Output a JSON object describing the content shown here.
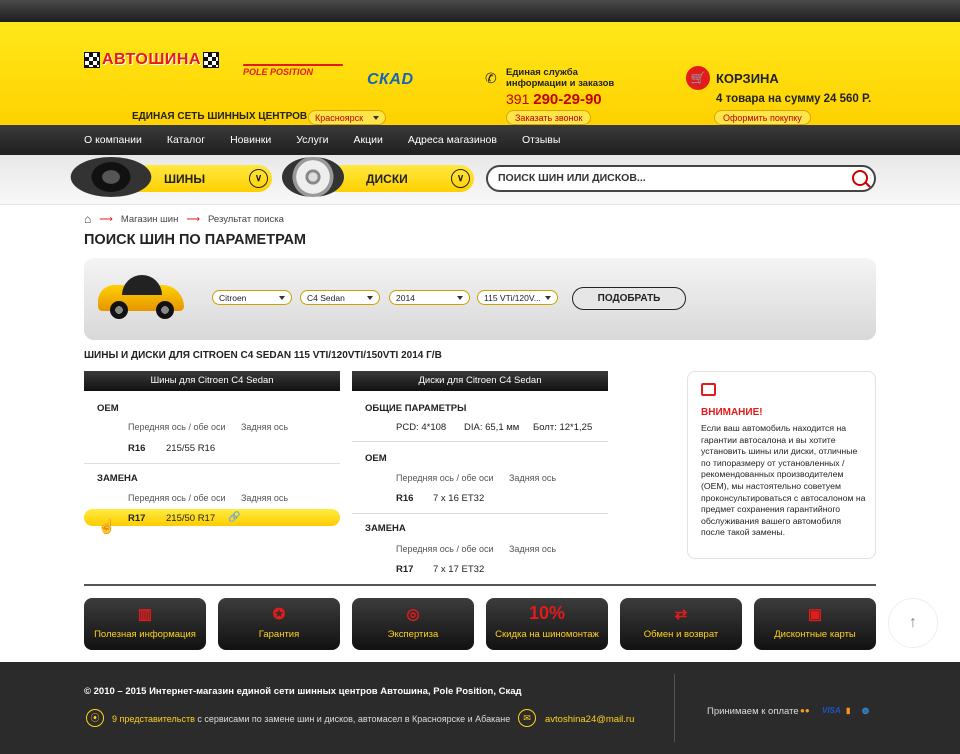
{
  "header": {
    "logo_avtoshina": "АВТОШИНА",
    "logo_pole": "POLE POSITION",
    "logo_skad": "СКАD",
    "network": "ЕДИНАЯ СЕТЬ ШИННЫХ ЦЕНТРОВ",
    "city": "Красноярск",
    "service_line1": "Единая служба",
    "service_line2": "информации и заказов",
    "phone_code": "391",
    "phone_number": "290-29-90",
    "callback": "Заказать звонок",
    "cart_title": "КОРЗИНА",
    "cart_sum": "4 товара на сумму 24 560 Р.",
    "checkout": "Оформить покупку"
  },
  "menu": [
    "О компании",
    "Каталог",
    "Новинки",
    "Услуги",
    "Акции",
    "Адреса магазинов",
    "Отзывы"
  ],
  "search": {
    "tires": "ШИНЫ",
    "disks": "ДИСКИ",
    "placeholder": "ПОИСК ШИН ИЛИ ДИСКОВ..."
  },
  "breadcrumb": [
    "Магазин шин",
    "Результат поиска"
  ],
  "page_title": "ПОИСК ШИН ПО ПАРАМЕТРАМ",
  "filter": {
    "make": "Citroen",
    "model": "C4 Sedan",
    "year": "2014",
    "engine": "115 VTi/120V...",
    "button": "ПОДОБРАТЬ"
  },
  "results_title": "ШИНЫ И ДИСКИ ДЛЯ CITROEN C4 SEDAN 115 VTI/120VTI/150VTI 2014 Г/В",
  "tires": {
    "tab": "Шины для Citroen C4 Sedan",
    "oem_title": "OEM",
    "col_front": "Передняя ось / обе оси",
    "col_rear": "Задняя ось",
    "oem_rim": "R16",
    "oem_size": "215/55 R16",
    "repl_title": "ЗАМЕНА",
    "repl_rim": "R17",
    "repl_size": "215/50 R17"
  },
  "disks": {
    "tab": "Диски для Citroen C4 Sedan",
    "general_title": "ОБЩИЕ ПАРАМЕТРЫ",
    "pcd": "PCD: 4*108",
    "dia": "DIA: 65,1 мм",
    "bolt": "Болт: 12*1,25",
    "oem_title": "OEM",
    "col_front": "Передняя ось / обе оси",
    "col_rear": "Задняя ось",
    "oem_rim": "R16",
    "oem_size": "7 x 16 ET32",
    "repl_title": "ЗАМЕНА",
    "repl_rim": "R17",
    "repl_size": "7 x 17 ET32"
  },
  "notice": {
    "title": "ВНИМАНИЕ!",
    "text": "Если ваш автомобиль находится на гарантии автосалона и вы хотите установить шины или диски, отличные по типоразмеру от установленных / рекомендованных производителем (OEM), мы настоятельно советуем проконсультироваться с автосалоном на предмет сохранения гарантийного обслуживания вашего автомобиля после такой замены."
  },
  "features": [
    {
      "icon": "book-icon",
      "glyph": "▥",
      "label": "Полезная информация"
    },
    {
      "icon": "award-icon",
      "glyph": "✪",
      "label": "Гарантия"
    },
    {
      "icon": "wheel-search-icon",
      "glyph": "◎",
      "label": "Экспертиза"
    },
    {
      "icon": "percent-badge",
      "glyph": "10%",
      "label": "Скидка на шиномонтаж"
    },
    {
      "icon": "exchange-icon",
      "glyph": "⇄",
      "label": "Обмен и возврат"
    },
    {
      "icon": "card-icon",
      "glyph": "▣",
      "label": "Дисконтные карты"
    }
  ],
  "footer": {
    "copyright": "© 2010 – 2015 Интернет-магазин единой сети шинных центров Автошина, Pole Position, Скад",
    "reps_link": "9 представительств",
    "reps_text": " с сервисами по замене шин и дисков, автомасел в Красноярске и Абакане",
    "email": "avtoshina24@mail.ru",
    "payment": "Принимаем к оплате"
  },
  "colors": {
    "accent": "#ffd21a",
    "brand_red": "#e41b1b",
    "dark": "#222222"
  }
}
